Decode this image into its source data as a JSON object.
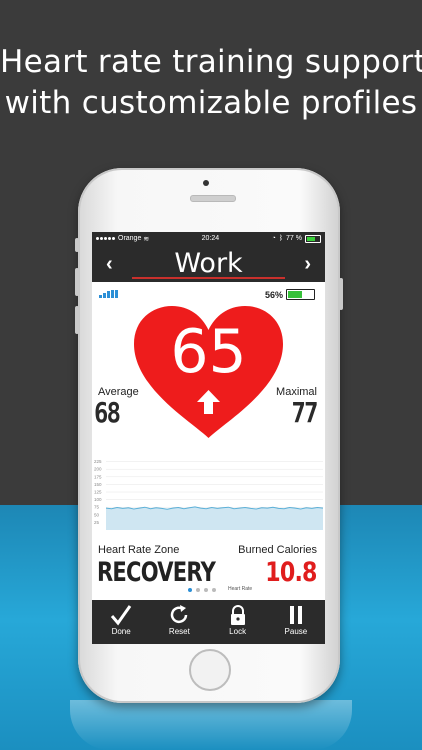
{
  "headline": {
    "line1": "Heart rate training support",
    "line2": "with customizable profiles"
  },
  "status_bar": {
    "carrier": "Orange",
    "time": "20:24",
    "battery": "77 %"
  },
  "profile": {
    "title": "Work",
    "prev_arrow": "‹",
    "next_arrow": "›"
  },
  "sensor": {
    "battery_percent": "56%",
    "battery_level": 0.56,
    "signal_bars": 5
  },
  "heart_rate": {
    "current": "65",
    "trend": "up"
  },
  "stats": {
    "average_label": "Average",
    "average_value": "68",
    "maximal_label": "Maximal",
    "maximal_value": "77"
  },
  "graph": {
    "y_ticks": [
      "225",
      "200",
      "175",
      "150",
      "125",
      "100",
      "75",
      "50",
      "25"
    ],
    "series": [
      72,
      70,
      74,
      71,
      73,
      69,
      72,
      75,
      70,
      73,
      71,
      68,
      72,
      74,
      70,
      73,
      76,
      72,
      70,
      74,
      71,
      73,
      75,
      70,
      72,
      74,
      71,
      69,
      73,
      72,
      75,
      71,
      70,
      74,
      72,
      69,
      73,
      71,
      74,
      72
    ],
    "ylim": [
      0,
      250
    ],
    "line_color": "#5bb0d8",
    "fill_color": "#cfe6f2"
  },
  "zone": {
    "label": "Heart Rate Zone",
    "value": "RECOVERY"
  },
  "calories": {
    "label": "Burned Calories",
    "value": "10.8"
  },
  "pager": {
    "label": "Heart Rate",
    "pages": 4,
    "active": 0
  },
  "toolbar": [
    {
      "label": "Done",
      "icon": "checkmark-icon"
    },
    {
      "label": "Reset",
      "icon": "reset-icon"
    },
    {
      "label": "Lock",
      "icon": "lock-icon"
    },
    {
      "label": "Pause",
      "icon": "pause-icon"
    }
  ],
  "colors": {
    "heart": "#ee1c1c",
    "accent_blue": "#2b8fd6",
    "calories_red": "#e01d1d"
  }
}
